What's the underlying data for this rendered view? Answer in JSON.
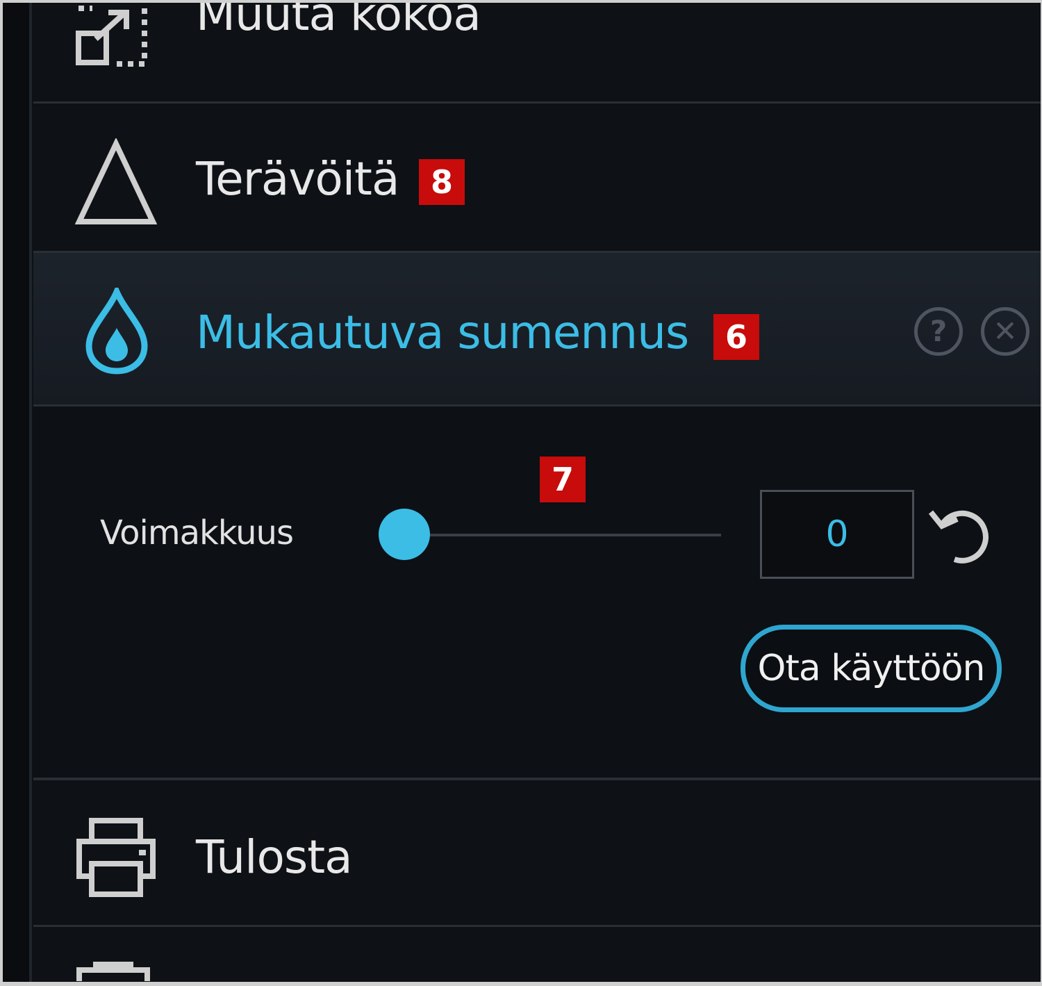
{
  "menu": {
    "resize_label": "Muuta kokoa",
    "sharpen_label": "Terävöitä",
    "sharpen_badge": "8",
    "blur_label": "Mukautuva sumennus",
    "blur_badge": "6",
    "print_label": "Tulosta"
  },
  "panel": {
    "badge": "7",
    "strength_label": "Voimakkuus",
    "strength_value": "0",
    "strength_level": 0,
    "apply_label": "Ota käyttöön"
  },
  "icons": {
    "resize": "resize-icon",
    "sharpen": "triangle-icon",
    "blur": "droplet-icon",
    "print": "printer-icon",
    "help": "help-icon",
    "close": "close-icon",
    "reset": "undo-icon"
  },
  "colors": {
    "accent": "#3bbde6",
    "badge": "#c80b0b",
    "background": "#0e1116"
  }
}
